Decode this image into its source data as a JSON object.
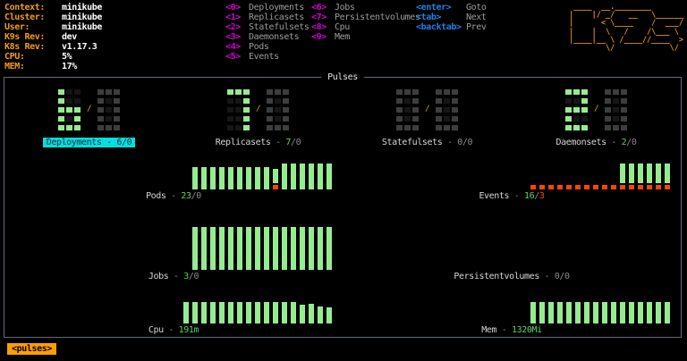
{
  "header": {
    "info": [
      {
        "label": "Context:",
        "value": "minikube"
      },
      {
        "label": "Cluster:",
        "value": "minikube"
      },
      {
        "label": "User:",
        "value": "minikube"
      },
      {
        "label": "K9s Rev:",
        "value": "dev"
      },
      {
        "label": "K8s Rev:",
        "value": "v1.17.3"
      },
      {
        "label": "CPU:",
        "value": "5%"
      },
      {
        "label": "MEM:",
        "value": "17%"
      }
    ],
    "menu_col1": [
      {
        "key": "<0>",
        "label": "Deployments"
      },
      {
        "key": "<1>",
        "label": "Replicasets"
      },
      {
        "key": "<2>",
        "label": "Statefulsets"
      },
      {
        "key": "<3>",
        "label": "Daemonsets"
      },
      {
        "key": "<4>",
        "label": "Pods"
      },
      {
        "key": "<5>",
        "label": "Events"
      }
    ],
    "menu_col2": [
      {
        "key": "<6>",
        "label": "Jobs"
      },
      {
        "key": "<7>",
        "label": "Persistentvolumes"
      },
      {
        "key": "<8>",
        "label": "Cpu"
      },
      {
        "key": "<9>",
        "label": "Mem"
      }
    ],
    "nav_keys": [
      {
        "key": "<enter>",
        "label": "Goto"
      },
      {
        "key": "<tab>",
        "label": "Next"
      },
      {
        "key": "<backtab>",
        "label": "Prev"
      }
    ],
    "logo_lines": [
      " ____  __.________       ",
      "|    |/ _/   __   \\______",
      "|      < \\____    /  ___/",
      "|    |  \\   /    /\\___ \\ ",
      "|____|__ \\ /____//____  >",
      "        \\/            \\/ "
    ]
  },
  "panel_title": "Pulses",
  "label_separator": "-",
  "label_slash": "/",
  "pulses": [
    {
      "id": "deployments",
      "row": 1,
      "title": "Deployments",
      "value": "6",
      "fault": "0",
      "digits": "6/0",
      "selected": true
    },
    {
      "id": "replicasets",
      "row": 1,
      "title": "Replicasets",
      "value": "7",
      "fault": "0",
      "digits": "7/0"
    },
    {
      "id": "statefulsets",
      "row": 1,
      "title": "Statefulsets",
      "value": "0",
      "fault": "0",
      "digits": "0/0"
    },
    {
      "id": "daemonsets",
      "row": 1,
      "title": "Daemonsets",
      "value": "2",
      "fault": "0",
      "digits": "2/0"
    },
    {
      "id": "pods",
      "row": 2,
      "title": "Pods",
      "value": "23",
      "fault": "0",
      "bars": {
        "heights": [
          25,
          25,
          25,
          25,
          25,
          25,
          25,
          25,
          25,
          16,
          29,
          29,
          29,
          29,
          29,
          29
        ],
        "error_cols": [
          9
        ]
      }
    },
    {
      "id": "events",
      "row": 2,
      "title": "Events",
      "value": "16",
      "fault": "3",
      "bars": {
        "heights": [
          0,
          0,
          0,
          0,
          0,
          0,
          0,
          0,
          0,
          0,
          22,
          22,
          22,
          22,
          22,
          22
        ],
        "error_cols": [
          0,
          1,
          2,
          3,
          4,
          5,
          6,
          7,
          8,
          9,
          10,
          11,
          12,
          13,
          14,
          15
        ]
      }
    },
    {
      "id": "jobs",
      "row": 3,
      "title": "Jobs",
      "value": "3",
      "fault": "0",
      "bars": {
        "heights": [
          48,
          48,
          48,
          48,
          48,
          48,
          48,
          48,
          48,
          48,
          48,
          48,
          48,
          48,
          48,
          48
        ],
        "error_cols": []
      }
    },
    {
      "id": "persistentvolumes",
      "row": 3,
      "title": "Persistentvolumes",
      "value": "0",
      "fault": "0",
      "bars": {
        "heights": [],
        "error_cols": []
      }
    },
    {
      "id": "cpu",
      "row": 4,
      "title": "Cpu",
      "value": "191m",
      "fault": null,
      "bars": {
        "heights": [
          24,
          24,
          24,
          24,
          24,
          24,
          24,
          24,
          24,
          24,
          24,
          24,
          24,
          21,
          22,
          19,
          18
        ],
        "error_cols": []
      }
    },
    {
      "id": "mem",
      "row": 4,
      "title": "Mem",
      "value": "1320Mi",
      "fault": null,
      "bars": {
        "heights": [
          24,
          24,
          24,
          24,
          24,
          24,
          24,
          24,
          24,
          24,
          24,
          24,
          24,
          24,
          24,
          24
        ],
        "error_cols": []
      }
    }
  ],
  "crumb": "<pulses>",
  "colors": {
    "accent_orange": "#ff9f00",
    "header_orange": "#f29c19",
    "bar_green": "#95ec8f",
    "label_green": "#5fd160",
    "digit_dim": "#3d3d3d",
    "label_dim": "#8b8b8b",
    "error_red": "#ff4500",
    "selection_cyan": "#00e0e0",
    "hotkey_magenta": "#d400d4",
    "navkey_blue": "#2080e0"
  }
}
